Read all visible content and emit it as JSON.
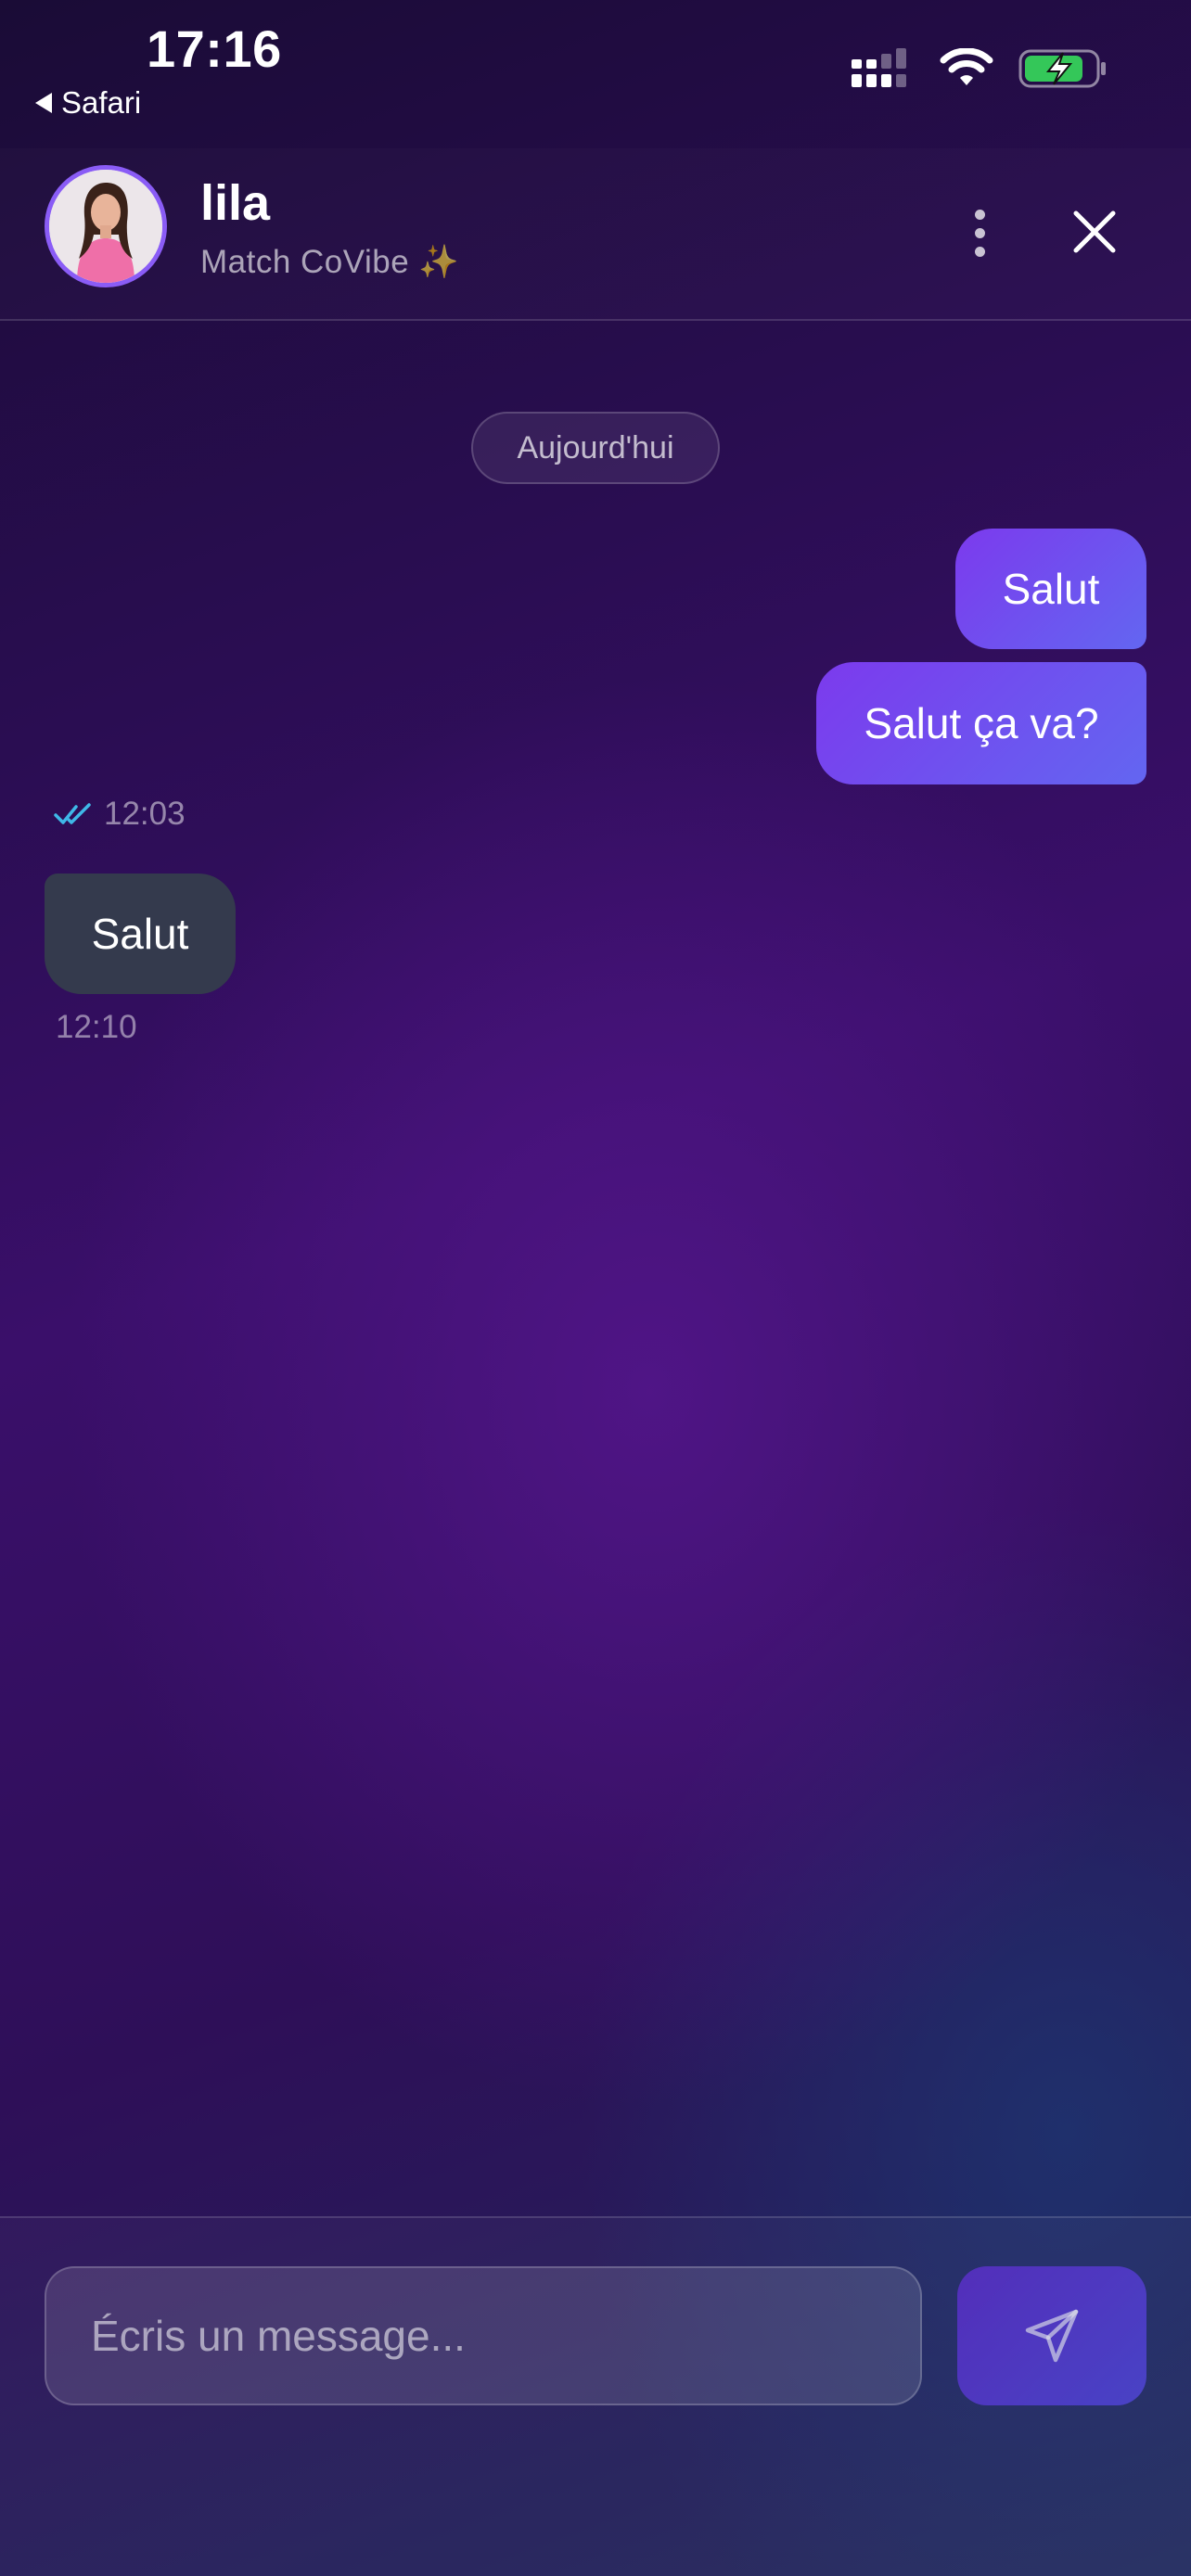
{
  "status_bar": {
    "time": "17:16",
    "back_app": "Safari",
    "battery_color": "#34c759"
  },
  "header": {
    "name": "lila",
    "subtitle": "Match CoVibe ✨",
    "avatar_border_color": "#8a5cf6"
  },
  "chat": {
    "date_label": "Aujourd'hui",
    "outgoing": [
      {
        "text": "Salut"
      },
      {
        "text": "Salut ça va?"
      }
    ],
    "read_time": "12:03",
    "incoming": [
      {
        "text": "Salut",
        "time": "12:10"
      }
    ],
    "accent_gradient": [
      "#7c3aed",
      "#6366f1"
    ],
    "read_check_color": "#3fb8e8"
  },
  "composer": {
    "placeholder": "Écris un message...",
    "value": ""
  },
  "icons": {
    "back": "triangle-left-icon",
    "signal": "signal-bars-icon",
    "wifi": "wifi-icon",
    "battery": "battery-charging-icon",
    "more": "more-vertical-icon",
    "close": "close-icon",
    "read": "double-check-icon",
    "send": "send-icon"
  }
}
